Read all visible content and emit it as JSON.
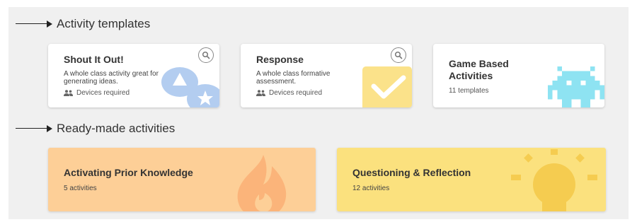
{
  "sections": {
    "templates_heading": "Activity templates",
    "ready_heading": "Ready-made activities"
  },
  "templates": [
    {
      "title": "Shout It Out!",
      "description": "A whole class activity great for generating ideas.",
      "meta": "Devices required",
      "icon": "shapes-icon",
      "accent": "#b3cdf0"
    },
    {
      "title": "Response",
      "description": "A whole class formative assessment.",
      "meta": "Devices required",
      "icon": "checkmark-icon",
      "accent": "#fbe28a"
    },
    {
      "title": "Game Based Activities",
      "description": "11 templates",
      "icon": "space-invader-icon",
      "accent": "#8ee3f2"
    }
  ],
  "ready": [
    {
      "title": "Activating Prior Knowledge",
      "count": "5 activities",
      "icon": "flame-icon",
      "background": "#fdcf97",
      "accent": "#fbb47a"
    },
    {
      "title": "Questioning & Reflection",
      "count": "12 activities",
      "icon": "lightbulb-icon",
      "background": "#fbe17e",
      "accent": "#f5cc50"
    }
  ]
}
